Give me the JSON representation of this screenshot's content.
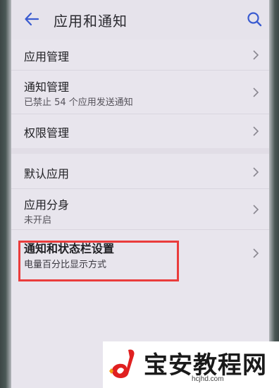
{
  "header": {
    "title": "应用和通知",
    "back_icon": "back-arrow-icon",
    "search_icon": "search-icon",
    "accent_color": "#3a5bd0"
  },
  "list": {
    "items": [
      {
        "label": "应用管理",
        "sub": ""
      },
      {
        "label": "通知管理",
        "sub": "已禁止 54 个应用发送通知"
      },
      {
        "label": "权限管理",
        "sub": ""
      },
      {
        "label": "默认应用",
        "sub": ""
      },
      {
        "label": "应用分身",
        "sub": "未开启"
      },
      {
        "label": "通知和状态栏设置",
        "sub": "电量百分比显示方式"
      }
    ]
  },
  "annotation": {
    "highlight_color": "#ea3c3c"
  },
  "watermark": {
    "text": "宝安教程网",
    "domain": "hcjhd.com",
    "logo_color": "#e02020"
  }
}
